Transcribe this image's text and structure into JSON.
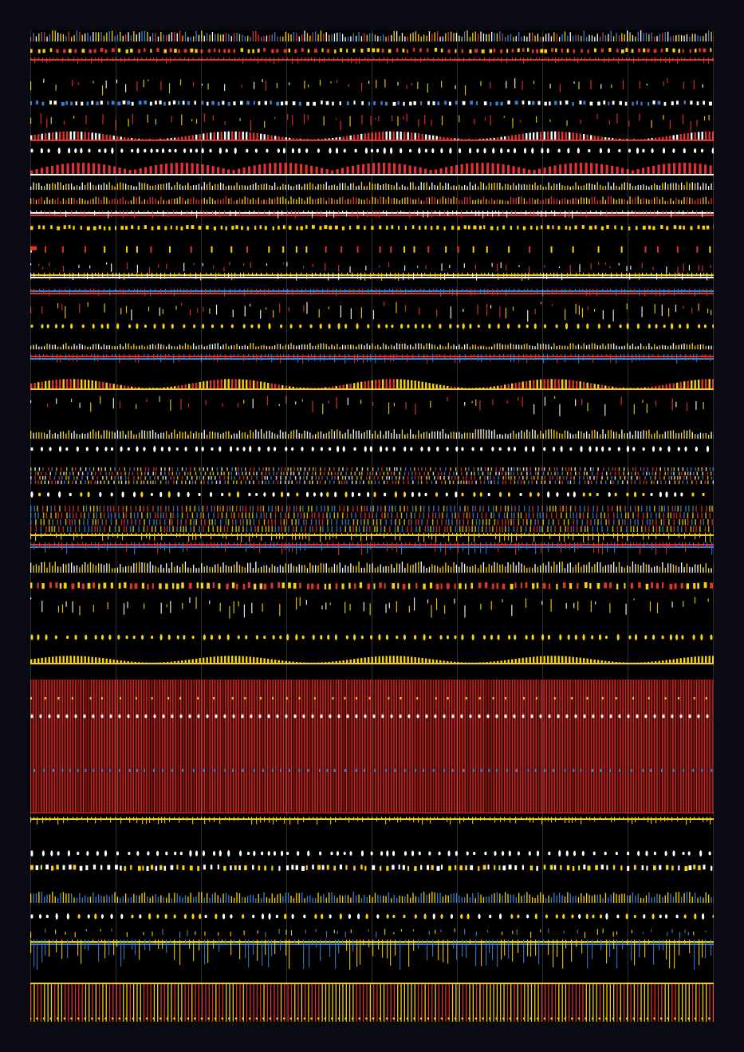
{
  "artwork": {
    "background": "#000000",
    "frame_color": "#0a0b12",
    "palette": {
      "red": "#e2322c",
      "yellow": "#f7d20a",
      "white": "#ffffff",
      "blue": "#3a7fd0",
      "dark_red": "#a01e1a"
    },
    "bands": [
      {
        "name": "band-top-ticks",
        "kind": "ticks",
        "colors": [
          "red",
          "yellow",
          "blue",
          "white"
        ]
      },
      {
        "name": "band-yellow-dashes-1",
        "kind": "dashes",
        "colors": [
          "yellow",
          "red"
        ]
      },
      {
        "name": "band-red-line-1",
        "kind": "line",
        "colors": [
          "red"
        ]
      },
      {
        "name": "band-sparse-1",
        "kind": "sparse",
        "colors": [
          "white",
          "red",
          "yellow"
        ]
      },
      {
        "name": "band-blue-dashes",
        "kind": "dashes",
        "colors": [
          "blue",
          "white"
        ]
      },
      {
        "name": "band-sparse-2",
        "kind": "sparse",
        "colors": [
          "yellow",
          "red"
        ]
      },
      {
        "name": "band-red-wave",
        "kind": "wave",
        "colors": [
          "red",
          "white"
        ]
      },
      {
        "name": "band-white-dots-1",
        "kind": "dots",
        "colors": [
          "white"
        ]
      },
      {
        "name": "band-red-bars-1",
        "kind": "bars",
        "colors": [
          "red",
          "white"
        ]
      },
      {
        "name": "band-yellow-ticks-1",
        "kind": "ticks",
        "colors": [
          "yellow",
          "white"
        ]
      },
      {
        "name": "band-yellow-ticks-2",
        "kind": "ticks",
        "colors": [
          "yellow",
          "red"
        ]
      },
      {
        "name": "band-white-line-1",
        "kind": "line",
        "colors": [
          "white",
          "red"
        ]
      },
      {
        "name": "band-yellow-dashes-2",
        "kind": "dashes",
        "colors": [
          "yellow"
        ]
      },
      {
        "name": "band-red-blocks",
        "kind": "blocks",
        "colors": [
          "red",
          "yellow"
        ]
      },
      {
        "name": "band-sparse-3",
        "kind": "sparse",
        "colors": [
          "red",
          "white"
        ]
      },
      {
        "name": "band-yellow-line-2",
        "kind": "line",
        "colors": [
          "yellow",
          "white"
        ]
      },
      {
        "name": "band-blue-line",
        "kind": "line",
        "colors": [
          "blue",
          "red"
        ]
      },
      {
        "name": "band-sparse-4",
        "kind": "sparse",
        "colors": [
          "yellow",
          "red",
          "white"
        ]
      },
      {
        "name": "band-yellow-dots-1",
        "kind": "dots",
        "colors": [
          "yellow"
        ]
      },
      {
        "name": "band-white-ticks-1",
        "kind": "ticks",
        "colors": [
          "white",
          "yellow"
        ]
      },
      {
        "name": "band-red-line-2",
        "kind": "line",
        "colors": [
          "red",
          "blue"
        ]
      },
      {
        "name": "band-yellow-wave",
        "kind": "wave",
        "colors": [
          "yellow",
          "red"
        ]
      },
      {
        "name": "band-sparse-5",
        "kind": "sparse",
        "colors": [
          "white",
          "red",
          "yellow"
        ]
      },
      {
        "name": "band-yellow-ticks-3",
        "kind": "ticks",
        "colors": [
          "yellow",
          "white"
        ]
      },
      {
        "name": "band-white-dots-2",
        "kind": "dots",
        "colors": [
          "white"
        ]
      },
      {
        "name": "band-mixed-dense-1",
        "kind": "dense",
        "colors": [
          "yellow",
          "blue",
          "red",
          "white"
        ]
      },
      {
        "name": "band-yellow-dots-2",
        "kind": "dots",
        "colors": [
          "yellow",
          "white"
        ]
      },
      {
        "name": "band-mixed-dense-2",
        "kind": "dense",
        "colors": [
          "yellow",
          "red",
          "blue"
        ]
      },
      {
        "name": "band-yellow-line-3",
        "kind": "line",
        "colors": [
          "yellow"
        ]
      },
      {
        "name": "band-red-line-3",
        "kind": "line",
        "colors": [
          "red",
          "blue"
        ]
      },
      {
        "name": "band-white-ticks-2",
        "kind": "ticks",
        "colors": [
          "white",
          "yellow"
        ]
      },
      {
        "name": "band-yellow-dashes-3",
        "kind": "dashes",
        "colors": [
          "yellow",
          "red"
        ]
      },
      {
        "name": "band-sparse-6",
        "kind": "sparse",
        "colors": [
          "white",
          "yellow"
        ]
      },
      {
        "name": "band-yellow-dots-3",
        "kind": "dots",
        "colors": [
          "yellow"
        ]
      },
      {
        "name": "band-yellow-wave-2",
        "kind": "wave",
        "colors": [
          "yellow"
        ]
      },
      {
        "name": "band-red-curtain",
        "kind": "curtain",
        "colors": [
          "red",
          "white",
          "blue",
          "yellow"
        ]
      },
      {
        "name": "band-yellow-thick-line",
        "kind": "line",
        "colors": [
          "yellow"
        ]
      },
      {
        "name": "band-white-dots-3",
        "kind": "dots",
        "colors": [
          "white"
        ]
      },
      {
        "name": "band-yellow-dashes-4",
        "kind": "dashes",
        "colors": [
          "yellow",
          "white"
        ]
      },
      {
        "name": "band-blue-ticks",
        "kind": "ticks",
        "colors": [
          "blue",
          "yellow"
        ]
      },
      {
        "name": "band-white-dots-4",
        "kind": "dots",
        "colors": [
          "white",
          "yellow"
        ]
      },
      {
        "name": "band-sparse-7",
        "kind": "sparse",
        "colors": [
          "yellow",
          "blue"
        ]
      },
      {
        "name": "band-yellow-line-4",
        "kind": "line",
        "colors": [
          "yellow",
          "blue"
        ]
      },
      {
        "name": "band-red-comb",
        "kind": "comb",
        "colors": [
          "red",
          "yellow"
        ]
      }
    ]
  }
}
